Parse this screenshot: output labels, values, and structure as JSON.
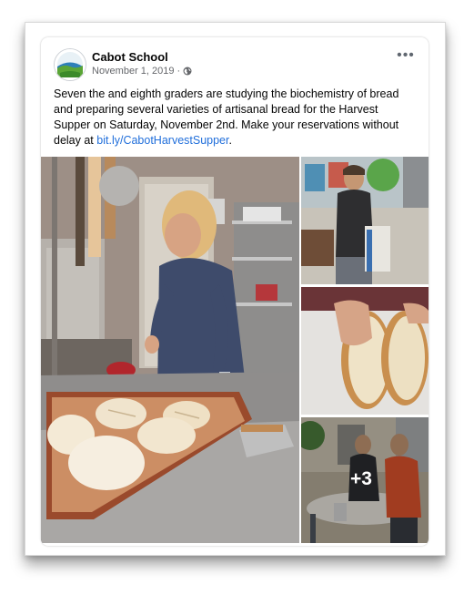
{
  "post": {
    "page_name": "Cabot School",
    "date": "November 1, 2019",
    "separator": "·",
    "audience_icon": "globe-icon",
    "menu_icon": "more-options-icon",
    "text_before_link": "Seven the and eighth graders are studying the biochemistry of bread and preparing several varieties of artisanal bread for the Harvest Supper on Saturday, November 2nd. Make your reservations without delay at ",
    "link_text": "bit.ly/CabotHarvestSupper",
    "text_after_link": ".",
    "link_color": "#216fdb"
  },
  "photos": {
    "main": "girl-scoring-bread-dough-photo",
    "side_1": "boy-working-in-kitchen-photo",
    "side_2": "sliced-bread-loaf-photo",
    "side_3": "students-around-table-photo",
    "more_count": "+3"
  },
  "colors": {
    "name_text": "#050505",
    "meta_text": "#65676b"
  }
}
